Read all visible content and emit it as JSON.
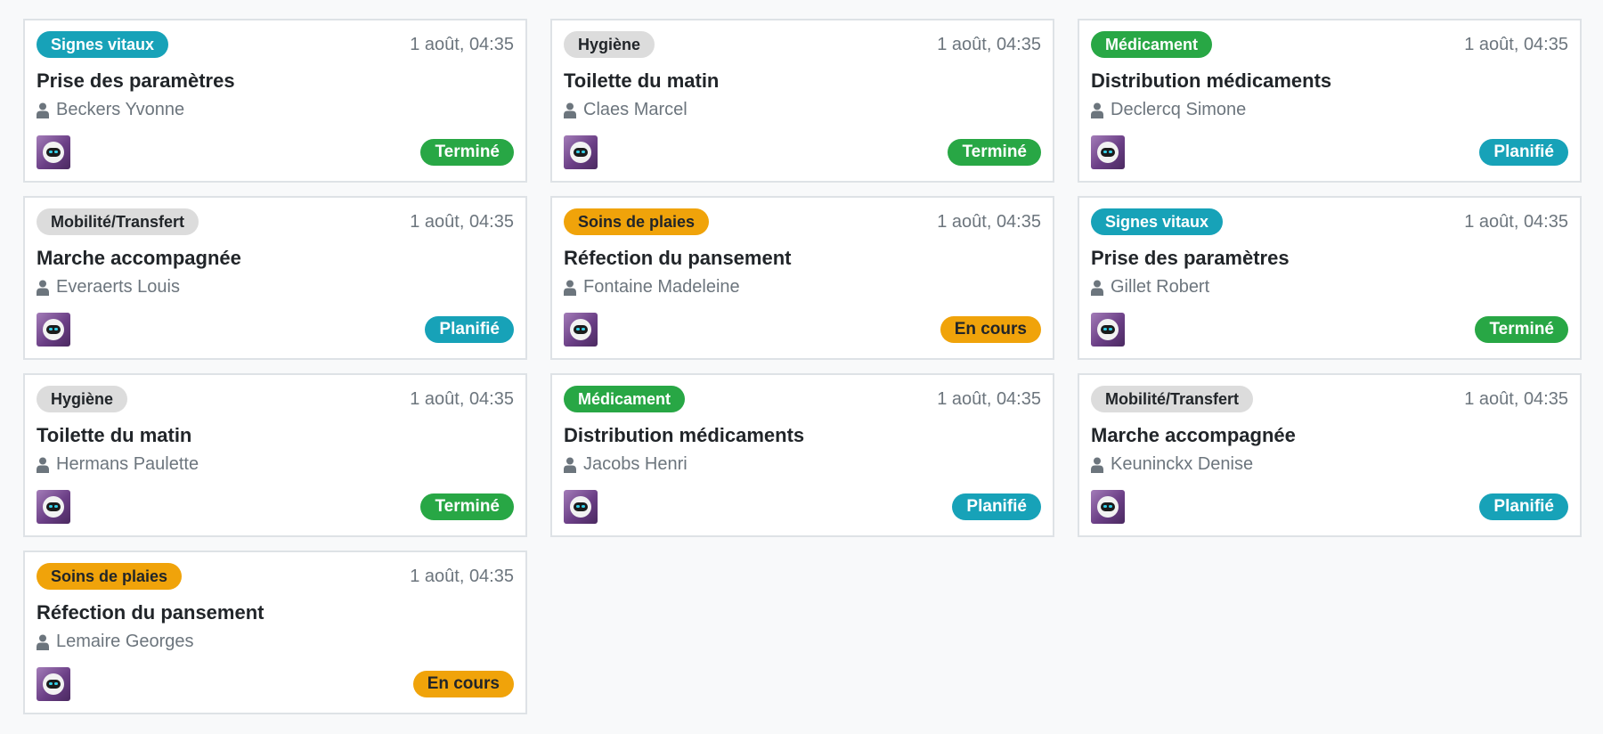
{
  "colors": {
    "vitals": "#17a2b8",
    "hygiene": "#dcdcdc",
    "meds": "#28a745",
    "mobility": "#dcdcdc",
    "wounds": "#f0a30a",
    "status_done": "#28a745",
    "status_planned": "#17a2b8",
    "status_in_progress": "#f0a30a"
  },
  "icons": {
    "patient": "user-icon",
    "avatar": "robot-avatar-icon"
  },
  "cards": [
    {
      "category": "Signes vitaux",
      "time": "1 août, 04:35",
      "title": "Prise des paramètres",
      "patient": "Beckers Yvonne",
      "status": "Terminé"
    },
    {
      "category": "Hygiène",
      "time": "1 août, 04:35",
      "title": "Toilette du matin",
      "patient": "Claes Marcel",
      "status": "Terminé"
    },
    {
      "category": "Médicament",
      "time": "1 août, 04:35",
      "title": "Distribution médicaments",
      "patient": "Declercq Simone",
      "status": "Planifié"
    },
    {
      "category": "Mobilité/Transfert",
      "time": "1 août, 04:35",
      "title": "Marche accompagnée",
      "patient": "Everaerts Louis",
      "status": "Planifié"
    },
    {
      "category": "Soins de plaies",
      "time": "1 août, 04:35",
      "title": "Réfection du pansement",
      "patient": "Fontaine Madeleine",
      "status": "En cours"
    },
    {
      "category": "Signes vitaux",
      "time": "1 août, 04:35",
      "title": "Prise des paramètres",
      "patient": "Gillet Robert",
      "status": "Terminé"
    },
    {
      "category": "Hygiène",
      "time": "1 août, 04:35",
      "title": "Toilette du matin",
      "patient": "Hermans Paulette",
      "status": "Terminé"
    },
    {
      "category": "Médicament",
      "time": "1 août, 04:35",
      "title": "Distribution médicaments",
      "patient": "Jacobs Henri",
      "status": "Planifié"
    },
    {
      "category": "Mobilité/Transfert",
      "time": "1 août, 04:35",
      "title": "Marche accompagnée",
      "patient": "Keuninckx Denise",
      "status": "Planifié"
    },
    {
      "category": "Soins de plaies",
      "time": "1 août, 04:35",
      "title": "Réfection du pansement",
      "patient": "Lemaire Georges",
      "status": "En cours"
    }
  ]
}
